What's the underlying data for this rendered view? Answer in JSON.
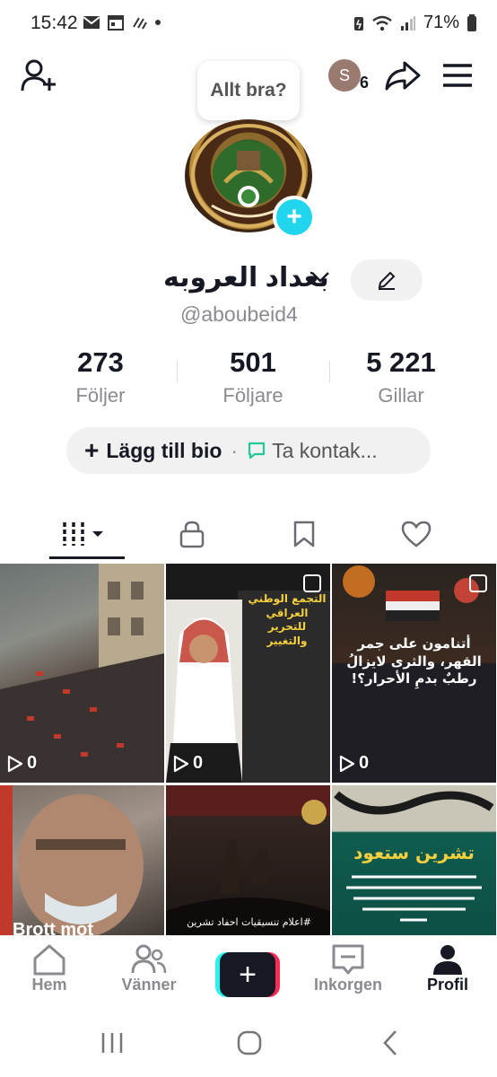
{
  "status_bar": {
    "time": "15:42",
    "battery": "71%",
    "icons": [
      "mail-icon",
      "calendar-icon",
      "flow-icon",
      "dot-icon",
      "battery-saver-icon",
      "wifi-icon",
      "signal-icon",
      "battery-icon"
    ]
  },
  "header": {
    "add_friend_icon": "person-plus-icon",
    "avatar_letter": "S",
    "avatar_count": "6",
    "share_icon": "share-arrow-icon",
    "menu_icon": "hamburger-icon",
    "tooltip": "Allt bra?"
  },
  "profile": {
    "name": "بغداد العروبه",
    "handle": "@aboubeid4",
    "picture_caption": "تجمع تنسيقيات احفاد ثورة تشرين"
  },
  "stats": [
    {
      "value": "273",
      "label": "Följer"
    },
    {
      "value": "501",
      "label": "Följare"
    },
    {
      "value": "5 221",
      "label": "Gillar"
    }
  ],
  "bio_bar": {
    "add_bio": "Lägg till bio",
    "separator": "·",
    "contact": "Ta kontak..."
  },
  "tabs": [
    "videos",
    "private",
    "saved",
    "liked"
  ],
  "videos": [
    {
      "views": "0",
      "kind": "street",
      "text": ""
    },
    {
      "views": "0",
      "kind": "man",
      "text": "التجمع الوطني العراقي للتحرير والتغيير"
    },
    {
      "views": "0",
      "kind": "fire",
      "text": "أتنامون على جمر القهر، والثرى لايزالُ رطبٌ بدمِ الأحرار؟!"
    },
    {
      "views": "",
      "kind": "face",
      "text": "Brott mot"
    },
    {
      "views": "",
      "kind": "protest",
      "text": "#اعلام تنسيقيات احفاد تشرين"
    },
    {
      "views": "",
      "kind": "banner",
      "text": "تشرين ستعود"
    }
  ],
  "bottom_nav": [
    {
      "label": "Hem",
      "icon": "home-icon"
    },
    {
      "label": "Vänner",
      "icon": "friends-icon"
    },
    {
      "label": "",
      "icon": "create-icon"
    },
    {
      "label": "Inkorgen",
      "icon": "inbox-icon"
    },
    {
      "label": "Profil",
      "icon": "profile-icon"
    }
  ],
  "colors": {
    "accent": "#20d5ec",
    "tiktok_red": "#fe2c55",
    "tiktok_cyan": "#25f4ee",
    "muted": "#8a8b91"
  }
}
